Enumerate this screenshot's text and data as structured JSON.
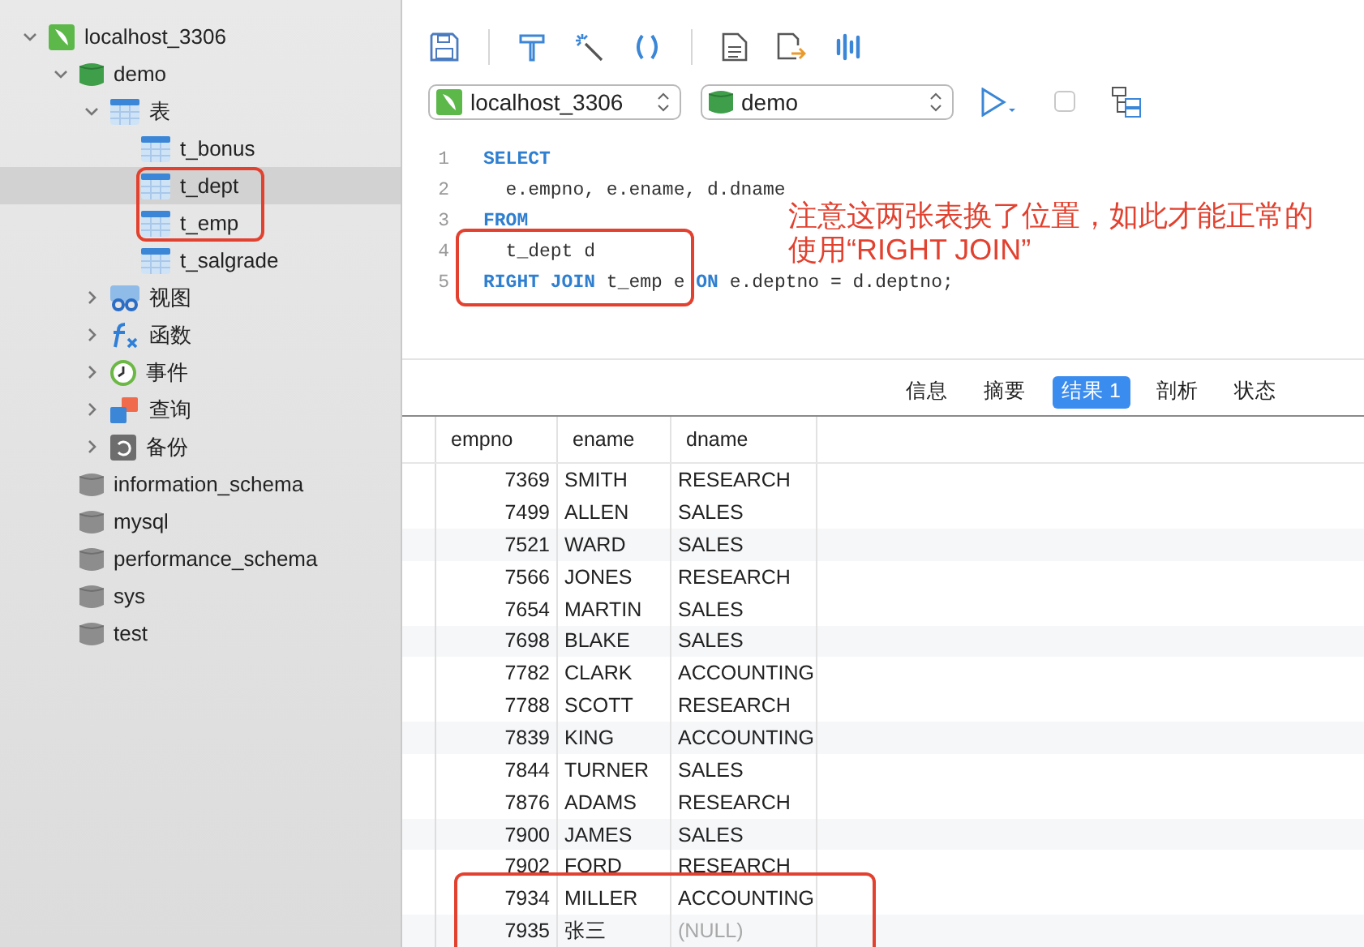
{
  "sidebar": {
    "tree": [
      {
        "label": "localhost_3306",
        "kind": "connection",
        "expanded": true,
        "selected": false,
        "children": [
          {
            "label": "demo",
            "kind": "database",
            "expanded": true,
            "selected": false,
            "children": [
              {
                "label": "表",
                "kind": "table-group",
                "expanded": true,
                "selected": false,
                "children": [
                  {
                    "label": "t_bonus",
                    "kind": "table",
                    "selected": false,
                    "annotated": false
                  },
                  {
                    "label": "t_dept",
                    "kind": "table",
                    "selected": true,
                    "annotated": true
                  },
                  {
                    "label": "t_emp",
                    "kind": "table",
                    "selected": false,
                    "annotated": true
                  },
                  {
                    "label": "t_salgrade",
                    "kind": "table",
                    "selected": false,
                    "annotated": false
                  }
                ]
              },
              {
                "label": "视图",
                "kind": "view",
                "expanded": false,
                "selected": false
              },
              {
                "label": "函数",
                "kind": "function",
                "expanded": false,
                "selected": false
              },
              {
                "label": "事件",
                "kind": "event",
                "expanded": false,
                "selected": false
              },
              {
                "label": "查询",
                "kind": "query",
                "expanded": false,
                "selected": false
              },
              {
                "label": "备份",
                "kind": "backup",
                "expanded": false,
                "selected": false
              }
            ]
          },
          {
            "label": "information_schema",
            "kind": "database-idle",
            "selected": false
          },
          {
            "label": "mysql",
            "kind": "database-idle",
            "selected": false
          },
          {
            "label": "performance_schema",
            "kind": "database-idle",
            "selected": false
          },
          {
            "label": "sys",
            "kind": "database-idle",
            "selected": false
          },
          {
            "label": "test",
            "kind": "database-idle",
            "selected": false
          }
        ]
      }
    ]
  },
  "connection_select": {
    "value": "localhost_3306"
  },
  "database_select": {
    "value": "demo"
  },
  "editor": {
    "lines": [
      {
        "number": "1",
        "annotated": false,
        "tokens": [
          {
            "kind": "keyword",
            "text": "SELECT"
          }
        ]
      },
      {
        "number": "2",
        "annotated": false,
        "tokens": [
          {
            "kind": "plain",
            "text": "  e.empno, e.ename, d.dname"
          }
        ]
      },
      {
        "number": "3",
        "annotated": false,
        "tokens": [
          {
            "kind": "keyword",
            "text": "FROM"
          }
        ]
      },
      {
        "number": "4",
        "annotated": true,
        "tokens": [
          {
            "kind": "plain",
            "text": "  t_dept d"
          }
        ]
      },
      {
        "number": "5",
        "annotated": true,
        "tokens": [
          {
            "kind": "keyword",
            "text": "RIGHT JOIN"
          },
          {
            "kind": "plain",
            "text": " t_emp e "
          },
          {
            "kind": "keyword",
            "text": "ON"
          },
          {
            "kind": "plain",
            "text": " e.deptno = d.deptno;"
          }
        ]
      }
    ],
    "note": "注意这两张表换了位置，如此才能正常的使用“RIGHT JOIN”"
  },
  "result_tabs": [
    {
      "label": "信息",
      "selected": false
    },
    {
      "label": "摘要",
      "selected": false
    },
    {
      "label": "结果 1",
      "selected": true
    },
    {
      "label": "剖析",
      "selected": false
    },
    {
      "label": "状态",
      "selected": false
    }
  ],
  "table": {
    "columns": [
      "empno",
      "ename",
      "dname"
    ],
    "rows": [
      {
        "cells": [
          "7369",
          "SMITH",
          "RESEARCH"
        ],
        "null_last": false,
        "annotated": false
      },
      {
        "cells": [
          "7499",
          "ALLEN",
          "SALES"
        ],
        "null_last": false,
        "annotated": false
      },
      {
        "cells": [
          "7521",
          "WARD",
          "SALES"
        ],
        "null_last": false,
        "annotated": false
      },
      {
        "cells": [
          "7566",
          "JONES",
          "RESEARCH"
        ],
        "null_last": false,
        "annotated": false
      },
      {
        "cells": [
          "7654",
          "MARTIN",
          "SALES"
        ],
        "null_last": false,
        "annotated": false
      },
      {
        "cells": [
          "7698",
          "BLAKE",
          "SALES"
        ],
        "null_last": false,
        "annotated": false
      },
      {
        "cells": [
          "7782",
          "CLARK",
          "ACCOUNTING"
        ],
        "null_last": false,
        "annotated": false
      },
      {
        "cells": [
          "7788",
          "SCOTT",
          "RESEARCH"
        ],
        "null_last": false,
        "annotated": false
      },
      {
        "cells": [
          "7839",
          "KING",
          "ACCOUNTING"
        ],
        "null_last": false,
        "annotated": false
      },
      {
        "cells": [
          "7844",
          "TURNER",
          "SALES"
        ],
        "null_last": false,
        "annotated": false
      },
      {
        "cells": [
          "7876",
          "ADAMS",
          "RESEARCH"
        ],
        "null_last": false,
        "annotated": false
      },
      {
        "cells": [
          "7900",
          "JAMES",
          "SALES"
        ],
        "null_last": false,
        "annotated": false
      },
      {
        "cells": [
          "7902",
          "FORD",
          "RESEARCH"
        ],
        "null_last": false,
        "annotated": false
      },
      {
        "cells": [
          "7934",
          "MILLER",
          "ACCOUNTING"
        ],
        "null_last": false,
        "annotated": true
      },
      {
        "cells": [
          "7935",
          "张三",
          "(NULL)"
        ],
        "null_last": true,
        "annotated": true
      }
    ]
  }
}
